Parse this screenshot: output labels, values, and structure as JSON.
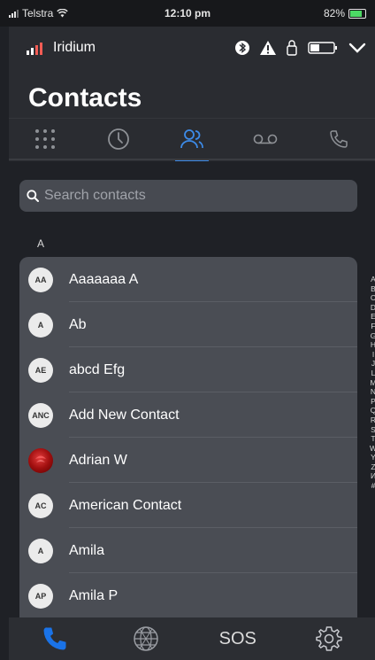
{
  "status_bar": {
    "carrier": "Telstra",
    "time": "12:10 pm",
    "battery_percent": "82%",
    "battery_level": 0.82
  },
  "device_bar": {
    "device_name": "Iridium",
    "icons": [
      "signal-bars-icon",
      "bluetooth-icon",
      "warning-icon",
      "lock-icon",
      "battery-icon",
      "chevron-down-icon"
    ]
  },
  "header": {
    "title": "Contacts",
    "tabs": [
      {
        "name": "keypad",
        "icon": "keypad-icon",
        "active": false
      },
      {
        "name": "recents",
        "icon": "clock-icon",
        "active": false
      },
      {
        "name": "contacts",
        "icon": "people-icon",
        "active": true
      },
      {
        "name": "voicemail",
        "icon": "voicemail-icon",
        "active": false
      },
      {
        "name": "call-log",
        "icon": "phone-icon",
        "active": false
      }
    ]
  },
  "search": {
    "placeholder": "Search contacts"
  },
  "section_letter": "A",
  "contacts": [
    {
      "initials": "AA",
      "name": "Aaaaaaa A"
    },
    {
      "initials": "A",
      "name": "Ab"
    },
    {
      "initials": "AE",
      "name": "abcd Efg"
    },
    {
      "initials": "ANC",
      "name": "Add New Contact"
    },
    {
      "initials": "",
      "name": "Adrian W",
      "photo": true
    },
    {
      "initials": "AC",
      "name": "American Contact"
    },
    {
      "initials": "A",
      "name": "Amila"
    },
    {
      "initials": "AP",
      "name": "Amila P"
    }
  ],
  "alphabet_index": [
    "A",
    "B",
    "C",
    "D",
    "E",
    "F",
    "G",
    "H",
    "I",
    "J",
    "L",
    "M",
    "N",
    "P",
    "Q",
    "R",
    "S",
    "T",
    "W",
    "Y",
    "Z",
    "И",
    "#"
  ],
  "bottom_nav": {
    "sos_label": "SOS",
    "active_color": "#1a73e8"
  },
  "colors": {
    "accent": "#3d8be8",
    "background": "#1f2126",
    "panel": "#2a2c31",
    "list_bg": "#4a4d54"
  }
}
